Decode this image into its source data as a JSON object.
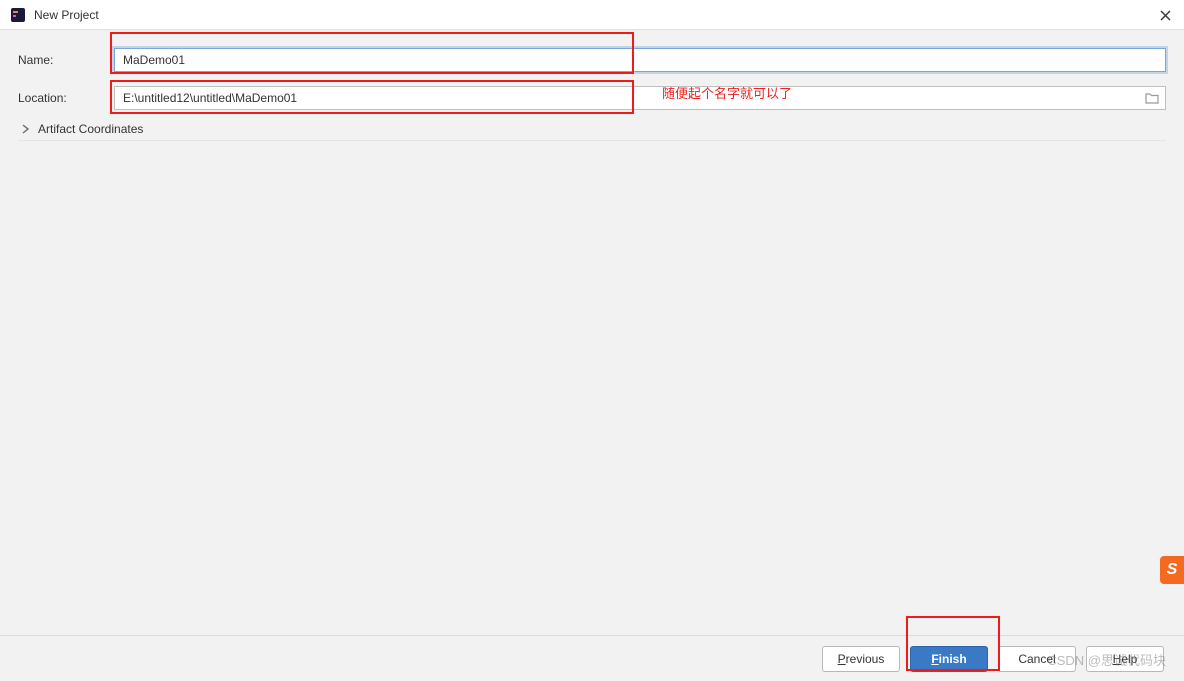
{
  "window": {
    "title": "New Project"
  },
  "form": {
    "name_label": "Name:",
    "name_value": "MaDemo01",
    "location_label": "Location:",
    "location_value": "E:\\untitled12\\untitled\\MaDemo01",
    "artifact_label": "Artifact Coordinates"
  },
  "annotation": {
    "text": "随便起个名字就可以了"
  },
  "buttons": {
    "previous": "Previous",
    "finish": "Finish",
    "cancel": "Cancel",
    "help": "Help"
  },
  "watermark": "CSDN @思诚代码块",
  "badge": "S"
}
